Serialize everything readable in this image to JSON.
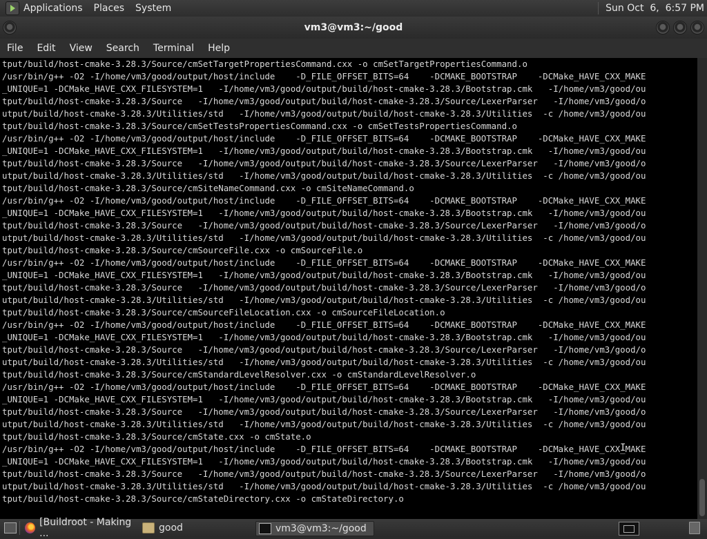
{
  "top_panel": {
    "menus": [
      "Applications",
      "Places",
      "System"
    ],
    "clock": "Sun Oct  6,  6:57 PM"
  },
  "window": {
    "title": "vm3@vm3:~/good",
    "menu": [
      "File",
      "Edit",
      "View",
      "Search",
      "Terminal",
      "Help"
    ]
  },
  "terminal": {
    "lines": [
      "tput/build/host-cmake-3.28.3/Source/cmSetTargetPropertiesCommand.cxx -o cmSetTargetPropertiesCommand.o",
      "/usr/bin/g++ -O2 -I/home/vm3/good/output/host/include    -D_FILE_OFFSET_BITS=64    -DCMAKE_BOOTSTRAP    -DCMake_HAVE_CXX_MAKE",
      "_UNIQUE=1 -DCMake_HAVE_CXX_FILESYSTEM=1   -I/home/vm3/good/output/build/host-cmake-3.28.3/Bootstrap.cmk   -I/home/vm3/good/ou",
      "tput/build/host-cmake-3.28.3/Source   -I/home/vm3/good/output/build/host-cmake-3.28.3/Source/LexerParser   -I/home/vm3/good/o",
      "utput/build/host-cmake-3.28.3/Utilities/std   -I/home/vm3/good/output/build/host-cmake-3.28.3/Utilities  -c /home/vm3/good/ou",
      "tput/build/host-cmake-3.28.3/Source/cmSetTestsPropertiesCommand.cxx -o cmSetTestsPropertiesCommand.o",
      "/usr/bin/g++ -O2 -I/home/vm3/good/output/host/include    -D_FILE_OFFSET_BITS=64    -DCMAKE_BOOTSTRAP    -DCMake_HAVE_CXX_MAKE",
      "_UNIQUE=1 -DCMake_HAVE_CXX_FILESYSTEM=1   -I/home/vm3/good/output/build/host-cmake-3.28.3/Bootstrap.cmk   -I/home/vm3/good/ou",
      "tput/build/host-cmake-3.28.3/Source   -I/home/vm3/good/output/build/host-cmake-3.28.3/Source/LexerParser   -I/home/vm3/good/o",
      "utput/build/host-cmake-3.28.3/Utilities/std   -I/home/vm3/good/output/build/host-cmake-3.28.3/Utilities  -c /home/vm3/good/ou",
      "tput/build/host-cmake-3.28.3/Source/cmSiteNameCommand.cxx -o cmSiteNameCommand.o",
      "/usr/bin/g++ -O2 -I/home/vm3/good/output/host/include    -D_FILE_OFFSET_BITS=64    -DCMAKE_BOOTSTRAP    -DCMake_HAVE_CXX_MAKE",
      "_UNIQUE=1 -DCMake_HAVE_CXX_FILESYSTEM=1   -I/home/vm3/good/output/build/host-cmake-3.28.3/Bootstrap.cmk   -I/home/vm3/good/ou",
      "tput/build/host-cmake-3.28.3/Source   -I/home/vm3/good/output/build/host-cmake-3.28.3/Source/LexerParser   -I/home/vm3/good/o",
      "utput/build/host-cmake-3.28.3/Utilities/std   -I/home/vm3/good/output/build/host-cmake-3.28.3/Utilities  -c /home/vm3/good/ou",
      "tput/build/host-cmake-3.28.3/Source/cmSourceFile.cxx -o cmSourceFile.o",
      "/usr/bin/g++ -O2 -I/home/vm3/good/output/host/include    -D_FILE_OFFSET_BITS=64    -DCMAKE_BOOTSTRAP    -DCMake_HAVE_CXX_MAKE",
      "_UNIQUE=1 -DCMake_HAVE_CXX_FILESYSTEM=1   -I/home/vm3/good/output/build/host-cmake-3.28.3/Bootstrap.cmk   -I/home/vm3/good/ou",
      "tput/build/host-cmake-3.28.3/Source   -I/home/vm3/good/output/build/host-cmake-3.28.3/Source/LexerParser   -I/home/vm3/good/o",
      "utput/build/host-cmake-3.28.3/Utilities/std   -I/home/vm3/good/output/build/host-cmake-3.28.3/Utilities  -c /home/vm3/good/ou",
      "tput/build/host-cmake-3.28.3/Source/cmSourceFileLocation.cxx -o cmSourceFileLocation.o",
      "/usr/bin/g++ -O2 -I/home/vm3/good/output/host/include    -D_FILE_OFFSET_BITS=64    -DCMAKE_BOOTSTRAP    -DCMake_HAVE_CXX_MAKE",
      "_UNIQUE=1 -DCMake_HAVE_CXX_FILESYSTEM=1   -I/home/vm3/good/output/build/host-cmake-3.28.3/Bootstrap.cmk   -I/home/vm3/good/ou",
      "tput/build/host-cmake-3.28.3/Source   -I/home/vm3/good/output/build/host-cmake-3.28.3/Source/LexerParser   -I/home/vm3/good/o",
      "utput/build/host-cmake-3.28.3/Utilities/std   -I/home/vm3/good/output/build/host-cmake-3.28.3/Utilities  -c /home/vm3/good/ou",
      "tput/build/host-cmake-3.28.3/Source/cmStandardLevelResolver.cxx -o cmStandardLevelResolver.o",
      "/usr/bin/g++ -O2 -I/home/vm3/good/output/host/include    -D_FILE_OFFSET_BITS=64    -DCMAKE_BOOTSTRAP    -DCMake_HAVE_CXX_MAKE",
      "_UNIQUE=1 -DCMake_HAVE_CXX_FILESYSTEM=1   -I/home/vm3/good/output/build/host-cmake-3.28.3/Bootstrap.cmk   -I/home/vm3/good/ou",
      "tput/build/host-cmake-3.28.3/Source   -I/home/vm3/good/output/build/host-cmake-3.28.3/Source/LexerParser   -I/home/vm3/good/o",
      "utput/build/host-cmake-3.28.3/Utilities/std   -I/home/vm3/good/output/build/host-cmake-3.28.3/Utilities  -c /home/vm3/good/ou",
      "tput/build/host-cmake-3.28.3/Source/cmState.cxx -o cmState.o",
      "/usr/bin/g++ -O2 -I/home/vm3/good/output/host/include    -D_FILE_OFFSET_BITS=64    -DCMAKE_BOOTSTRAP    -DCMake_HAVE_CXX_MAKE",
      "_UNIQUE=1 -DCMake_HAVE_CXX_FILESYSTEM=1   -I/home/vm3/good/output/build/host-cmake-3.28.3/Bootstrap.cmk   -I/home/vm3/good/ou",
      "tput/build/host-cmake-3.28.3/Source   -I/home/vm3/good/output/build/host-cmake-3.28.3/Source/LexerParser   -I/home/vm3/good/o",
      "utput/build/host-cmake-3.28.3/Utilities/std   -I/home/vm3/good/output/build/host-cmake-3.28.3/Utilities  -c /home/vm3/good/ou",
      "tput/build/host-cmake-3.28.3/Source/cmStateDirectory.cxx -o cmStateDirectory.o",
      ""
    ]
  },
  "taskbar": {
    "tasks": [
      {
        "label": "[Buildroot - Making ...",
        "icon": "firefox-icon"
      },
      {
        "label": "good",
        "icon": "folder-icon"
      },
      {
        "label": "vm3@vm3:~/good",
        "icon": "terminal-icon"
      }
    ]
  }
}
